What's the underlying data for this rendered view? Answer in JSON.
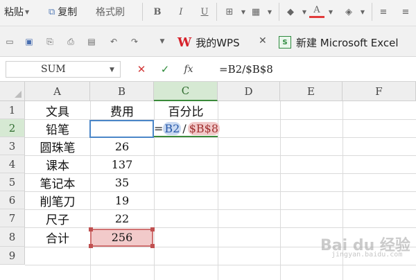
{
  "ribbon": {
    "paste_label": "粘贴",
    "copy_label": "复制",
    "format_painter_label": "格式刷",
    "bold_label": "B",
    "italic_label": "I",
    "underline_label": "U",
    "font_color_label": "A"
  },
  "tabs": [
    {
      "label": "我的WPS",
      "logo": "W"
    },
    {
      "label": "新建 Microsoft Excel",
      "logo": "S"
    }
  ],
  "formula_bar": {
    "name_box": "SUM",
    "cancel": "✕",
    "enter": "✓",
    "fx": "fx",
    "formula": "=B2/$B$8"
  },
  "columns": [
    "A",
    "B",
    "C",
    "D",
    "E",
    "F"
  ],
  "rows": [
    "1",
    "2",
    "3",
    "4",
    "5",
    "6",
    "7",
    "8",
    "9"
  ],
  "cells": {
    "A1": "文具",
    "B1": "费用",
    "C1": "百分比",
    "A2": "铅笔",
    "B2": "",
    "A3": "圆珠笔",
    "B3": "26",
    "A4": "课本",
    "B4": "137",
    "A5": "笔记本",
    "B5": "35",
    "A6": "削笔刀",
    "B6": "19",
    "A7": "尺子",
    "B7": "22",
    "A8": "合计",
    "B8": "256"
  },
  "c2_edit": {
    "eq": "=",
    "ref1": "B2",
    "op": "/",
    "ref2": "$B$8"
  },
  "watermark": {
    "text": "Bai du 经验",
    "sub": "jingyan.baidu.com"
  },
  "colors": {
    "active_header": "#d6e9d3",
    "ref_blue": "#4a86c8",
    "ref_red": "#d07070"
  }
}
